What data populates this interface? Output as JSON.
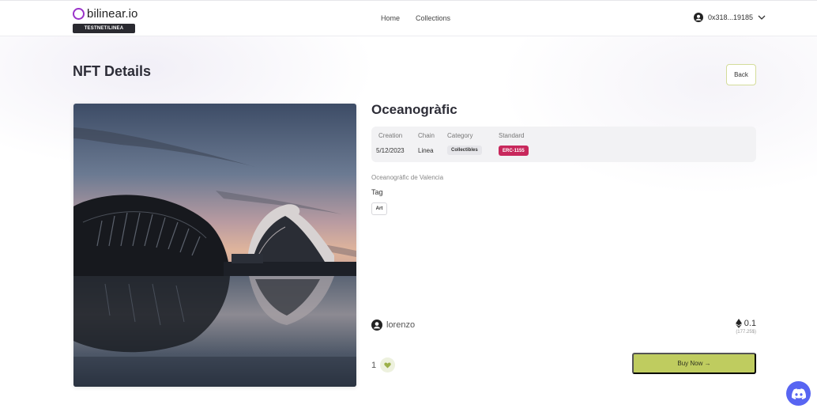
{
  "header": {
    "logo_text": "bilinear.io",
    "network_badge": "TESTNET/LINEA",
    "nav": [
      {
        "label": "Home"
      },
      {
        "label": "Collections"
      }
    ],
    "account_address": "0x318...19185"
  },
  "page": {
    "title": "NFT Details",
    "back_label": "Back"
  },
  "nft": {
    "name": "Oceanogràfic",
    "meta": {
      "creation_label": "Creation",
      "creation_value": "5/12/2023",
      "chain_label": "Chain",
      "chain_value": "Linea",
      "category_label": "Category",
      "category_value": "Collectibles",
      "standard_label": "Standard",
      "standard_value": "ERC-1155"
    },
    "description": "Oceanogràfic de Valencia",
    "tag_heading": "Tag",
    "tags": [
      "Art"
    ],
    "owner": "lorenzo",
    "price": "0.1",
    "price_usd": "(177.25$)",
    "likes": "1",
    "buy_label": "Buy Now →"
  },
  "colors": {
    "accent": "#bfcc5f",
    "standard_chip": "#c8285c",
    "logo": "#9a33c9",
    "discord": "#5865f2"
  },
  "icons": [
    "user-circle-icon",
    "chevron-down-icon",
    "ethereum-icon",
    "heart-icon",
    "discord-icon"
  ]
}
